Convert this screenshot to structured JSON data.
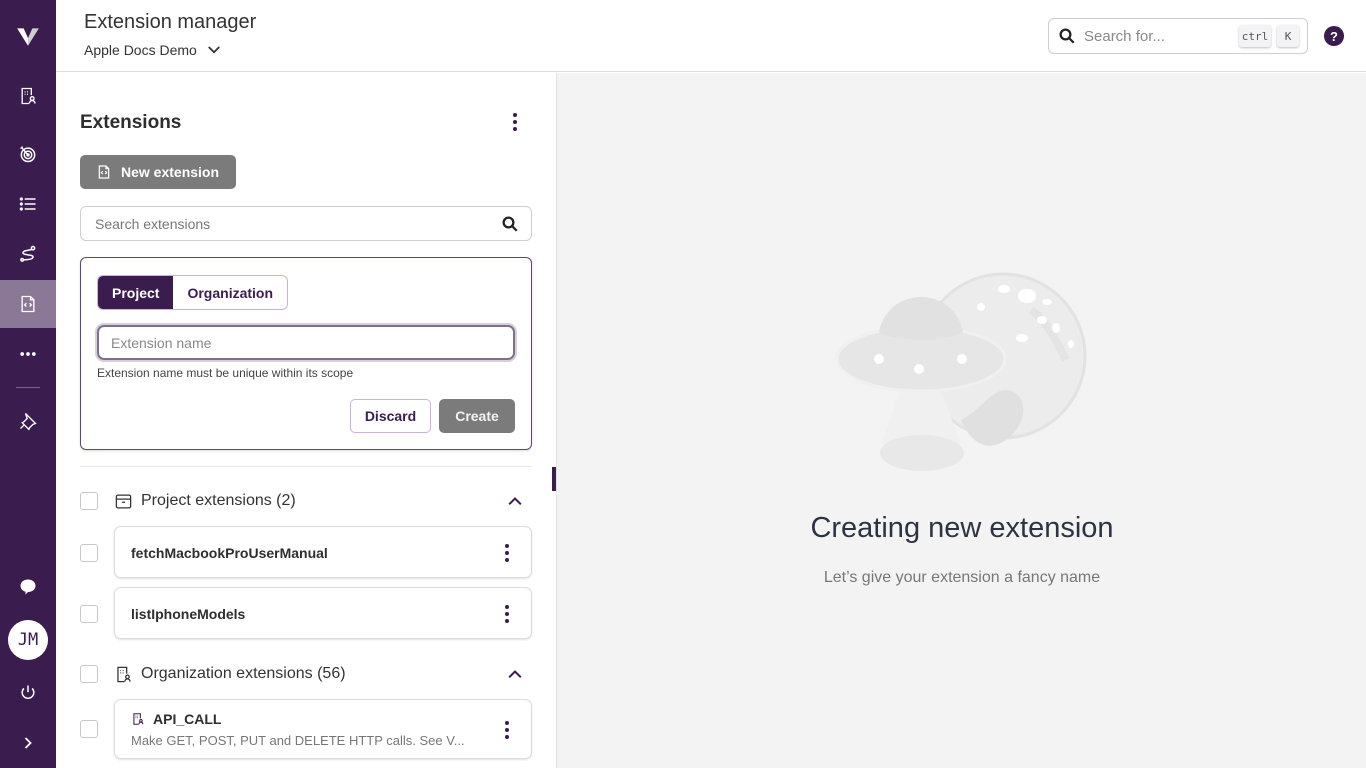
{
  "app": {
    "title": "Extension manager",
    "project": "Apple Docs Demo"
  },
  "sidebar": {
    "items": [
      {
        "name": "organization",
        "icon": "building-user-icon",
        "active": false
      },
      {
        "name": "targets",
        "icon": "target-icon",
        "active": false
      },
      {
        "name": "list",
        "icon": "list-icon",
        "active": false
      },
      {
        "name": "flows",
        "icon": "route-icon",
        "active": false
      },
      {
        "name": "extensions",
        "icon": "file-code-icon",
        "active": true
      },
      {
        "name": "more",
        "icon": "ellipsis-icon",
        "active": false
      },
      {
        "name": "pin",
        "icon": "pin-icon",
        "active": false
      }
    ],
    "chat_icon": "chat-bubble-icon",
    "avatar_initials": "JM",
    "power_icon": "power-icon",
    "expand_icon": "chevron-right-icon"
  },
  "topbar": {
    "search_placeholder": "Search for...",
    "shortcut_keys": [
      "ctrl",
      "K"
    ],
    "help_icon": "question-circle-icon",
    "help_glyph": "?"
  },
  "extensions_panel": {
    "title": "Extensions",
    "new_button": "New extension",
    "search_placeholder": "Search extensions",
    "create_form": {
      "scope_tabs": [
        {
          "label": "Project",
          "selected": true
        },
        {
          "label": "Organization",
          "selected": false
        }
      ],
      "name_value": "",
      "name_placeholder": "Extension name",
      "hint": "Extension name must be unique within its scope",
      "discard_label": "Discard",
      "create_label": "Create"
    },
    "groups": [
      {
        "label": "Project extensions (2)",
        "icon": "archive-box-icon",
        "expanded": true,
        "items": [
          {
            "name": "fetchMacbookProUserManual",
            "description": ""
          },
          {
            "name": "listIphoneModels",
            "description": ""
          }
        ]
      },
      {
        "label": "Organization extensions (56)",
        "icon": "building-user-icon",
        "expanded": true,
        "items": [
          {
            "name": "API_CALL",
            "description": "Make GET, POST, PUT and DELETE HTTP calls. See V...",
            "icon": "building-user-icon"
          }
        ]
      }
    ]
  },
  "main": {
    "empty_title": "Creating new extension",
    "empty_subtitle": "Let’s give your extension a fancy name",
    "illustration": "ufo-planet-illustration"
  },
  "colors": {
    "brand": "#3b1c4f",
    "sidebar_active": "#8b7896",
    "disabled_button": "#7b7b7b",
    "main_bg": "#f3f3f3"
  }
}
